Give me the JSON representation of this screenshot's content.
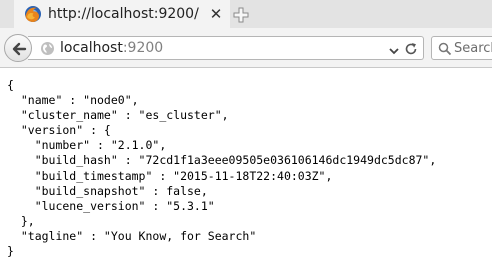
{
  "tab": {
    "title": "http://localhost:9200/",
    "close_glyph": "✕",
    "favicon": "firefox-icon"
  },
  "newtab": {
    "icon": "plus-icon"
  },
  "navbar": {
    "back_icon": "back-arrow-icon",
    "url_host": "localhost",
    "url_port": ":9200",
    "site_icon": "globe-icon",
    "dropdown_icon": "chevron-down-icon",
    "reload_icon": "reload-icon"
  },
  "search": {
    "placeholder": "Search",
    "icon": "search-icon"
  },
  "response": {
    "lines": [
      "{",
      "  \"name\" : \"node0\",",
      "  \"cluster_name\" : \"es_cluster\",",
      "  \"version\" : {",
      "    \"number\" : \"2.1.0\",",
      "    \"build_hash\" : \"72cd1f1a3eee09505e036106146dc1949dc5dc87\",",
      "    \"build_timestamp\" : \"2015-11-18T22:40:03Z\",",
      "    \"build_snapshot\" : false,",
      "    \"lucene_version\" : \"5.3.1\"",
      "  },",
      "  \"tagline\" : \"You Know, for Search\"",
      "}"
    ]
  }
}
